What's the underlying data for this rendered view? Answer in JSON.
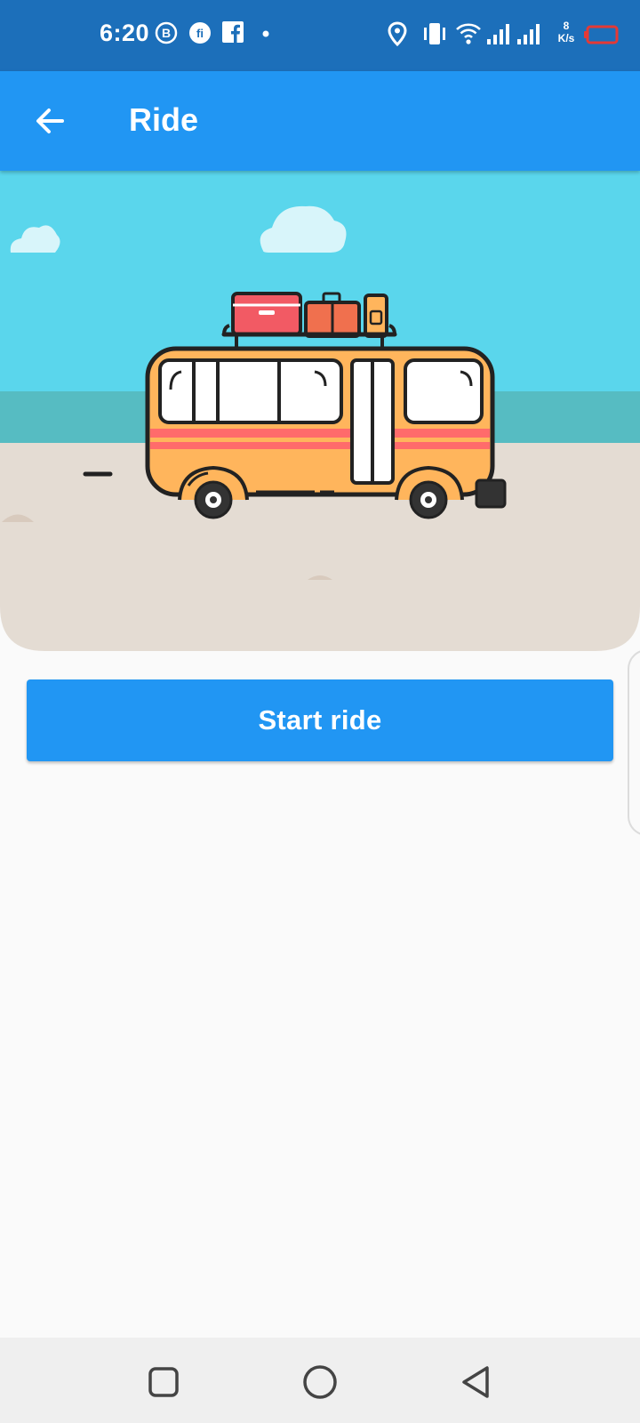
{
  "status_bar": {
    "time": "6:20",
    "net_speed_value": "8",
    "net_speed_unit": "K/s",
    "icons": [
      "b-badge-icon",
      "fi-icon",
      "facebook-icon",
      "dot-icon",
      "location-icon",
      "vibrate-icon",
      "wifi-icon",
      "signal-icon",
      "signal-icon",
      "battery-icon"
    ],
    "battery_color": "#e53935"
  },
  "app_bar": {
    "title": "Ride",
    "back_icon": "arrow-back-icon",
    "color": "#2196f3"
  },
  "main": {
    "start_button_label": "Start ride",
    "button_color": "#2196f3"
  },
  "nav_bar": {
    "icons": [
      "recents-square-icon",
      "home-circle-icon",
      "back-triangle-icon"
    ]
  }
}
